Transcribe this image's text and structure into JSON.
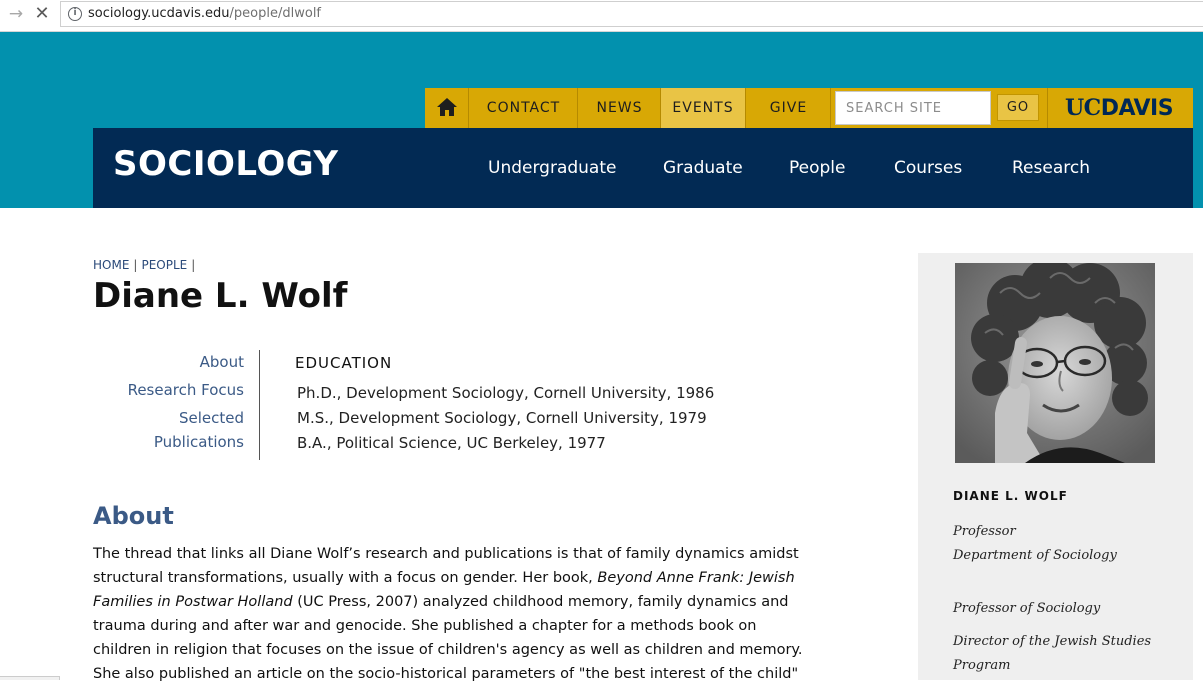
{
  "browser": {
    "nav_arrow": "→",
    "stop_glyph": "✕",
    "url_domain": "sociology.ucdavis.edu",
    "url_path": "/people/dlwolf"
  },
  "utility_nav": {
    "links": [
      "CONTACT",
      "NEWS",
      "EVENTS",
      "GIVE"
    ],
    "active": "EVENTS",
    "search_placeholder": "SEARCH SITE",
    "go_label": "GO",
    "logo_uc": "UC",
    "logo_davis": "DAVIS"
  },
  "main_nav": {
    "site_title": "SOCIOLOGY",
    "items": [
      "Undergraduate",
      "Graduate",
      "People",
      "Courses",
      "Research"
    ]
  },
  "breadcrumb": {
    "home": "HOME",
    "people": "PEOPLE",
    "sep": "|"
  },
  "page_title": "Diane L. Wolf",
  "local_nav": [
    "About",
    "Research Focus",
    "Selected",
    "Publications"
  ],
  "education": {
    "heading": "EDUCATION",
    "items": [
      "Ph.D., Development Sociology, Cornell University, 1986",
      "M.S., Development Sociology, Cornell University, 1979",
      "B.A., Political Science, UC Berkeley, 1977"
    ]
  },
  "about": {
    "heading": "About",
    "lines": [
      [
        "The thread that links all Diane Wolf’s research and publications is that of family dynamics amidst"
      ],
      [
        "structural transformations, usually with a focus on gender.  Her book, ",
        {
          "i": "Beyond Anne Frank: Jewish"
        }
      ],
      [
        {
          "i": "Families in Postwar Holland"
        },
        " (UC Press, 2007) analyzed childhood memory, family dynamics and"
      ],
      [
        "trauma during and after war and genocide. She published a chapter for a methods book on"
      ],
      [
        "children in religion that focuses on the issue of children's agency as well as children and memory."
      ],
      [
        "She also published an article on the socio-historical parameters of \"the best interest of the child\""
      ]
    ]
  },
  "sidebar": {
    "name": "DIANE L. WOLF",
    "roles": [
      "Professor",
      "Department of Sociology",
      "Professor of Sociology",
      "Director of the Jewish Studies",
      "Program"
    ]
  },
  "colors": {
    "teal": "#0291ae",
    "gold": "#d8a805",
    "navy": "#022a54",
    "link_blue": "#3b5a86"
  }
}
